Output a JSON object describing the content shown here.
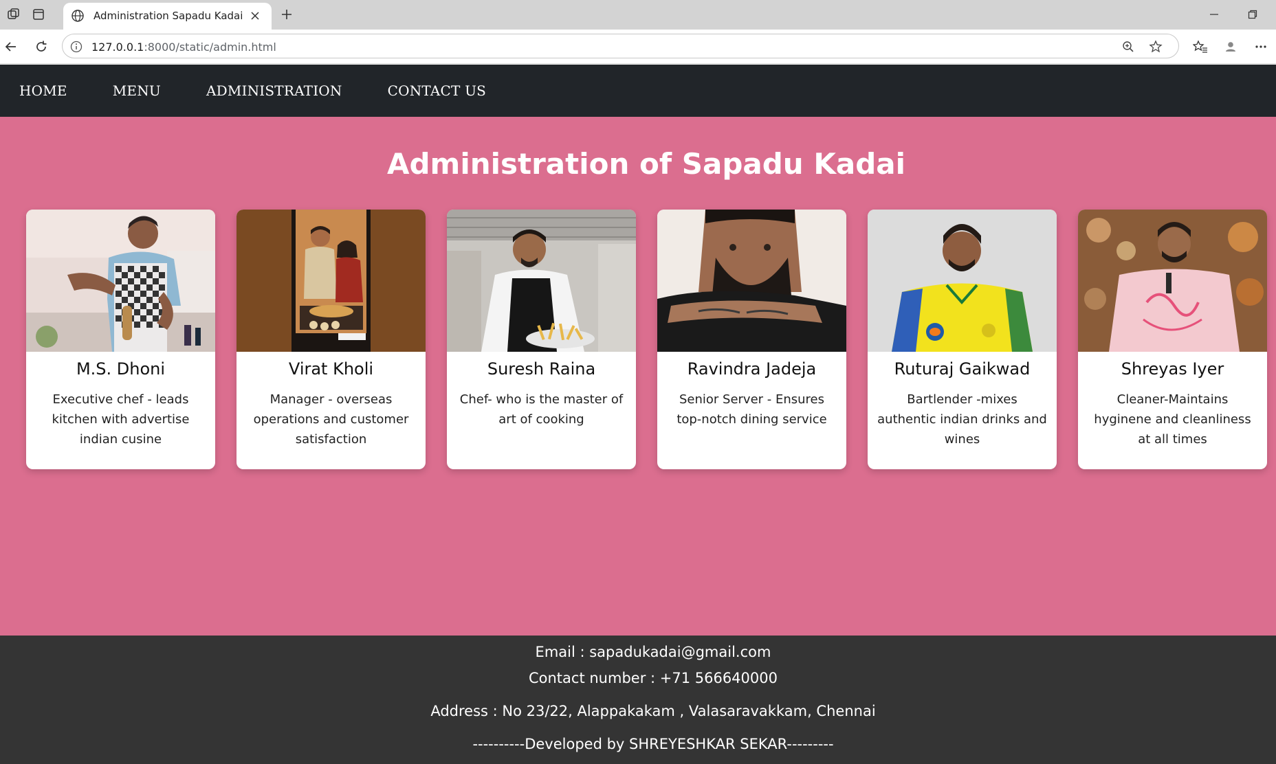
{
  "browser": {
    "tab_title": "Administration Sapadu Kadai",
    "url_host": "127.0.0.1",
    "url_path": ":8000/static/admin.html"
  },
  "nav": {
    "items": [
      {
        "label": "HOME"
      },
      {
        "label": "MENU"
      },
      {
        "label": "ADMINISTRATION"
      },
      {
        "label": "CONTACT US"
      }
    ]
  },
  "page": {
    "title": "Administration of Sapadu Kadai"
  },
  "staff": [
    {
      "name": "M.S. Dhoni",
      "role": "Executive chef - leads kitchen with advertise indian cusine"
    },
    {
      "name": "Virat Kholi",
      "role": "Manager - overseas operations and customer satisfaction"
    },
    {
      "name": "Suresh Raina",
      "role": "Chef- who is the master of art of cooking"
    },
    {
      "name": "Ravindra Jadeja",
      "role": "Senior Server - Ensures top-notch dining service"
    },
    {
      "name": "Ruturaj Gaikwad",
      "role": "Bartlender -mixes authentic indian drinks and wines"
    },
    {
      "name": "Shreyas Iyer",
      "role": "Cleaner-Maintains hyginene and cleanliness at all times"
    }
  ],
  "footer": {
    "email": "Email : sapadukadai@gmail.com",
    "contact": "Contact number : +71 566640000",
    "address": "Address : No 23/22, Alappakakam , Valasaravakkam, Chennai",
    "credit": "----------Developed by SHREYESHKAR SEKAR---------"
  },
  "colors": {
    "navbar": "#212529",
    "main_bg": "#db6e8f",
    "footer_bg": "#343434"
  }
}
